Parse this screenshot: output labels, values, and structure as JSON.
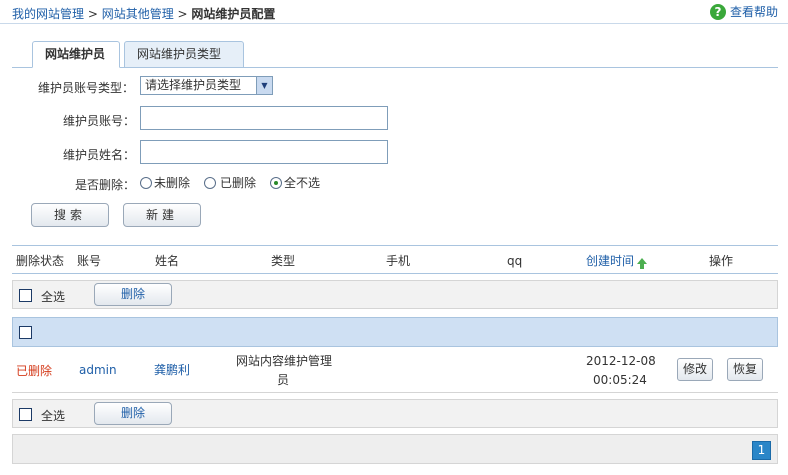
{
  "breadcrumb": {
    "item1": "我的网站管理",
    "sep1": " > ",
    "item2": "网站其他管理",
    "sep2": " > ",
    "current": "网站维护员配置"
  },
  "help": {
    "icon": "help-icon",
    "label": "查看帮助"
  },
  "tabs": [
    {
      "label": "网站维护员",
      "active": true
    },
    {
      "label": "网站维护员类型",
      "active": false
    }
  ],
  "form": {
    "type_label": "维护员账号类型：",
    "type_select_value": "请选择维护员类型",
    "account_label": "维护员账号：",
    "account_value": "",
    "name_label": "维护员姓名：",
    "name_value": "",
    "deleted_label": "是否删除：",
    "radios": [
      {
        "label": "未删除",
        "checked": false
      },
      {
        "label": "已删除",
        "checked": false
      },
      {
        "label": "全不选",
        "checked": true
      }
    ],
    "search_button": "搜索",
    "new_button": "新建"
  },
  "table": {
    "columns": [
      "删除状态",
      "账号",
      "姓名",
      "类型",
      "手机",
      "qq",
      "创建时间",
      "操作"
    ],
    "sort_column": "创建时间",
    "select_all_label": "全选",
    "delete_button": "删除",
    "rows": [
      {
        "status": "已删除",
        "account": "admin",
        "name": "龚鹏利",
        "type_line1": "网站内容维护管理",
        "type_line2": "员",
        "phone": "",
        "qq": "",
        "created_date": "2012-12-08",
        "created_time": "00:05:24",
        "edit_button": "修改",
        "restore_button": "恢复"
      }
    ]
  },
  "pager": {
    "current_page": "1"
  },
  "colors": {
    "link": "#1f5fa8",
    "deleted": "#d43a1a",
    "header_row": "#cfe0f3",
    "page_active": "#2a86c8"
  }
}
